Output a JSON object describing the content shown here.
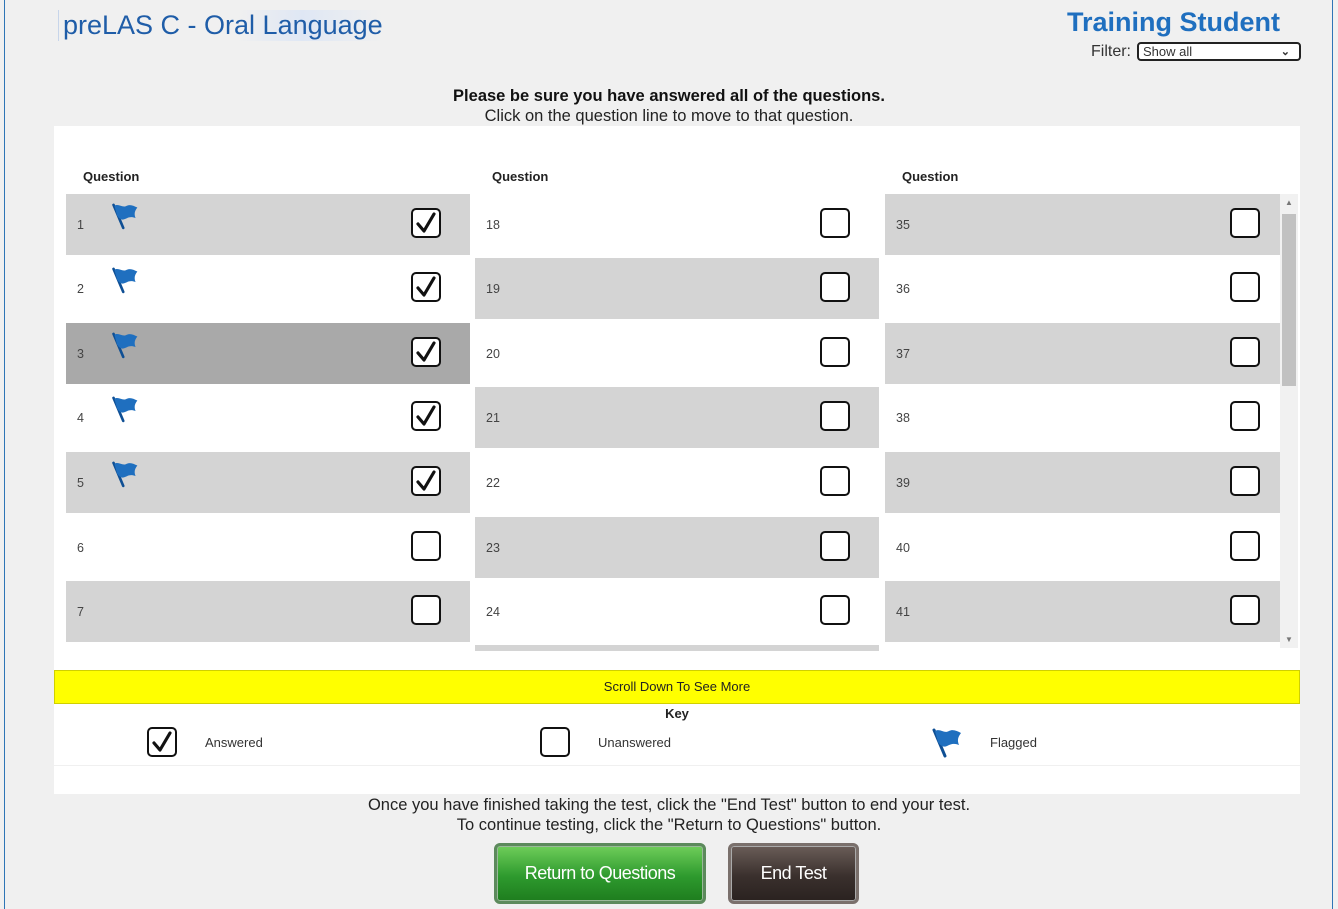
{
  "header": {
    "app_title": "preLAS C - Oral Language",
    "student_name": "Training Student",
    "filter_label": "Filter:",
    "filter_value": "Show all"
  },
  "instructions": {
    "line1": "Please be sure you have answered all of the questions.",
    "line2": "Click on the question line to move to that question."
  },
  "columns": [
    {
      "header": "Question",
      "rows": [
        {
          "num": "1",
          "flagged": true,
          "answered": true,
          "current": false
        },
        {
          "num": "2",
          "flagged": true,
          "answered": true,
          "current": false
        },
        {
          "num": "3",
          "flagged": true,
          "answered": true,
          "current": true
        },
        {
          "num": "4",
          "flagged": true,
          "answered": true,
          "current": false
        },
        {
          "num": "5",
          "flagged": true,
          "answered": true,
          "current": false
        },
        {
          "num": "6",
          "flagged": false,
          "answered": false,
          "current": false
        },
        {
          "num": "7",
          "flagged": false,
          "answered": false,
          "current": false
        }
      ]
    },
    {
      "header": "Question",
      "rows": [
        {
          "num": "18",
          "flagged": false,
          "answered": false,
          "current": false
        },
        {
          "num": "19",
          "flagged": false,
          "answered": false,
          "current": false
        },
        {
          "num": "20",
          "flagged": false,
          "answered": false,
          "current": false
        },
        {
          "num": "21",
          "flagged": false,
          "answered": false,
          "current": false
        },
        {
          "num": "22",
          "flagged": false,
          "answered": false,
          "current": false
        },
        {
          "num": "23",
          "flagged": false,
          "answered": false,
          "current": false
        },
        {
          "num": "24",
          "flagged": false,
          "answered": false,
          "current": false
        }
      ]
    },
    {
      "header": "Question",
      "rows": [
        {
          "num": "35",
          "flagged": false,
          "answered": false,
          "current": false
        },
        {
          "num": "36",
          "flagged": false,
          "answered": false,
          "current": false
        },
        {
          "num": "37",
          "flagged": false,
          "answered": false,
          "current": false
        },
        {
          "num": "38",
          "flagged": false,
          "answered": false,
          "current": false
        },
        {
          "num": "39",
          "flagged": false,
          "answered": false,
          "current": false
        },
        {
          "num": "40",
          "flagged": false,
          "answered": false,
          "current": false
        },
        {
          "num": "41",
          "flagged": false,
          "answered": false,
          "current": false
        }
      ]
    }
  ],
  "scroll_notice": "Scroll Down To See More",
  "key": {
    "title": "Key",
    "answered": "Answered",
    "unanswered": "Unanswered",
    "flagged": "Flagged"
  },
  "footer": {
    "line1": "Once you have finished taking the test, click the \"End Test\" button to end your test.",
    "line2": "To continue testing, click the \"Return to Questions\" button.",
    "return_button": "Return to Questions",
    "end_button": "End Test"
  },
  "colors": {
    "title_blue": "#1f5da8",
    "flag_blue": "#1f6fbf",
    "row_gray": "#d4d4d4",
    "current_row": "#a9a9a9",
    "notice_yellow": "#ffff00",
    "return_green": "#2e9a2e",
    "end_dark": "#3a302d"
  },
  "icons": {
    "flag": "flag-icon",
    "check": "checkmark-icon"
  }
}
